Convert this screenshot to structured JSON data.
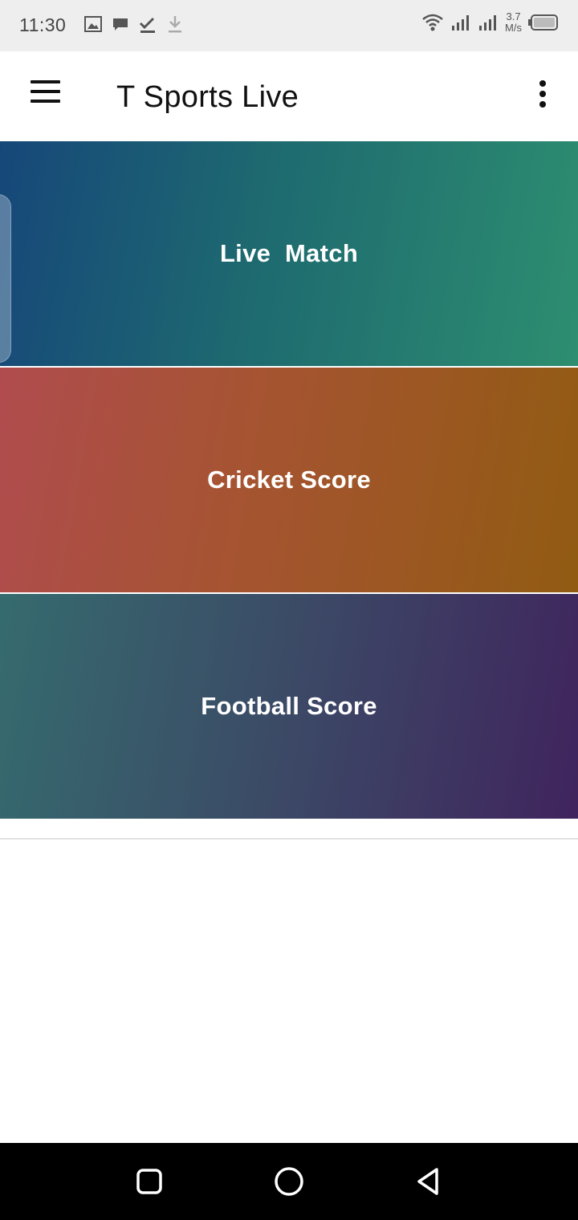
{
  "status_bar": {
    "time": "11:30",
    "speed_value": "3.7",
    "speed_unit": "M/s",
    "icons_left": [
      "image-icon",
      "chat-icon",
      "check-icon",
      "download-icon"
    ],
    "icons_right": [
      "wifi-icon",
      "signal-icon",
      "signal-icon",
      "battery-icon"
    ]
  },
  "app_bar": {
    "title": "T Sports Live",
    "menu_icon": "hamburger-menu-icon",
    "more_icon": "more-vertical-icon"
  },
  "cards": [
    {
      "label": "Live  Match"
    },
    {
      "label": "Cricket Score"
    },
    {
      "label": "Football Score"
    }
  ],
  "nav_bar": {
    "buttons": [
      "recent-apps-icon",
      "home-icon",
      "back-icon"
    ]
  },
  "colors": {
    "live_start": "#164779",
    "live_end": "#2d8e70",
    "cricket_start": "#b04c4e",
    "cricket_end": "#915b12",
    "football_start": "#356b6e",
    "football_end": "#40245d"
  }
}
